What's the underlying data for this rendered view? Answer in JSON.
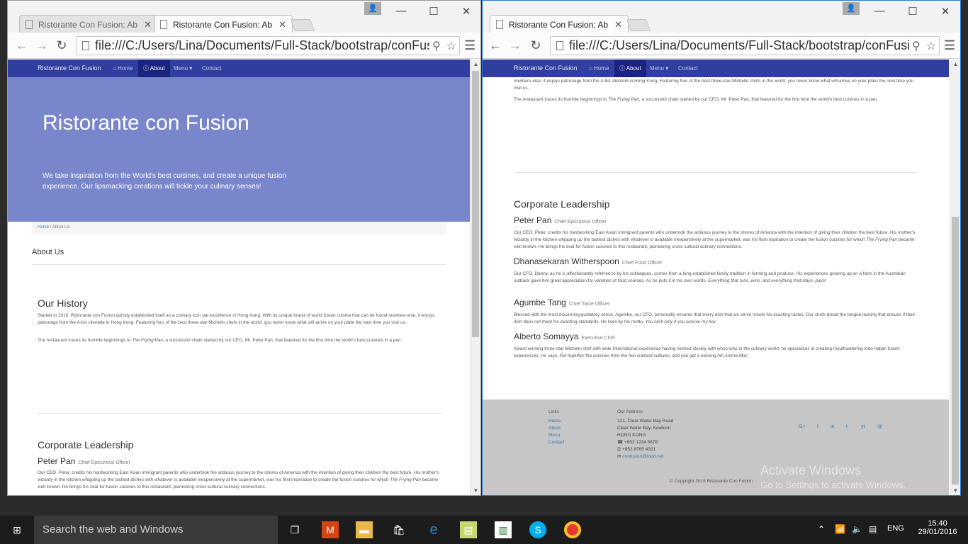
{
  "browser": {
    "tab_title": "Ristorante Con Fusion: Ab",
    "url": "file:///C:/Users/Lina/Documents/Full-Stack/bootstrap/conFusion/ab",
    "url_right": "file:///C:/Users/Lina/Documents/Full-Stack/bootstrap/conFusion/ab"
  },
  "site": {
    "brand": "Ristorante Con Fusion",
    "nav": {
      "home": "Home",
      "about": "About",
      "menu": "Menu",
      "contact": "Contact"
    },
    "jumbo_title": "Ristorante con Fusion",
    "jumbo_text": "We take inspiration from the World's best cuisines, and create a unique fusion experience. Our lipsmacking creations will tickle your culinary senses!",
    "breadcrumb": {
      "home": "Home",
      "sep": "/",
      "current": "About Us"
    },
    "page_heading": "About Us",
    "history_title": "Our History",
    "history_p1": "Started in 2010, Ristorante con Fusion quickly established itself as a culinary icon par excellence in Hong Kong. With its unique brand of world fusion cuisine that can be found nowhere else, it enjoys patronage from the A-list clientele in Hong Kong. Featuring four of the best three-star Michelin chefs in the world, you never know what will arrive on your plate the next time you visit us.",
    "history_p1_tail": "nowhere else, it enjoys patronage from the A-list clientele in Hong Kong. Featuring four of the best three-star Michelin chefs in the world, you never know what will arrive on your plate the next time you visit us.",
    "history_p2_pre": "The restaurant traces its humble beginnings to ",
    "history_p2_em": "The Frying Pan",
    "history_p2_post": ", a successful chain started by our CEO, Mr. Peter Pan, that featured for the first time the world's best cuisines in a pan.",
    "leadership_title": "Corporate Leadership",
    "leaders": [
      {
        "name": "Peter Pan",
        "title": "Chief Epicurious Officer",
        "pre": "Our CEO, Peter, credits his hardworking East Asian immigrant parents who undertook the arduous journey to the shores of America with the intention of giving their children the best future. His mother's wizardy in the kitchen whipping up the tastiest dishes with whatever is available inexpensively at the supermarket, was his first inspiration to create the fusion cuisines for which ",
        "em": "The Frying Pan",
        "post": " became well known. He brings his zeal for fusion cuisines to this restaurant, pioneering cross-cultural culinary connections."
      },
      {
        "name": "Dhanasekaran Witherspoon",
        "title": "Chief Food Officer",
        "pre": "Our CFO, Danny, as he is affectionately referred to by his colleagues, comes from a long established family tradition in farming and produce. His experiences growing up on a farm in the Australian outback gave him great appreciation for varieties of food sources. As he puts it in his own words, ",
        "em": "Everything that runs, wins, and everything that stays, pays!",
        "post": ""
      },
      {
        "name": "Agumbe Tang",
        "title": "Chief Taste Officer",
        "pre": "Blessed with the most discerning gustatory sense, Agumbe, our CFO, personally ensures that every dish that we serve meets his exacting tastes. Our chefs dread the tongue lashing that ensues if their dish does not meet his exacting standards. He lives by his motto, ",
        "em": "You click only if you survive my lick.",
        "post": ""
      },
      {
        "name": "Alberto Somayya",
        "title": "Executive Chef",
        "pre": "Award winning three-star Michelin chef with wide International experience having worked closely with whos-who in the culinary world, he specializes in creating mouthwatering Indo-Italian fusion experiences. He says, ",
        "em": "Put together the cuisines from the two craziest cultures, and you get a winning hit! Amma Mia!",
        "post": ""
      }
    ],
    "footer": {
      "links_title": "Links",
      "links": [
        "Home",
        "About",
        "Menu",
        "Contact"
      ],
      "address_title": "Our Address",
      "address": [
        "121, Clear Water Bay Road",
        "Clear Water Bay, Kowloon",
        "HONG KONG"
      ],
      "phone": "+852 1234 5678",
      "fax": "+852 8765 4321",
      "email": "confusion@food.net",
      "social": [
        "G+",
        "f",
        "in",
        "t",
        "yt",
        "@"
      ],
      "copyright": "© Copyright 2015 Ristorante Con Fusion"
    }
  },
  "watermark": {
    "line1": "Activate Windows",
    "line2": "Go to Settings to activate Windows."
  },
  "taskbar": {
    "search_placeholder": "Search the web and Windows",
    "language": "ENG",
    "time": "15:40",
    "date": "29/01/2016"
  }
}
